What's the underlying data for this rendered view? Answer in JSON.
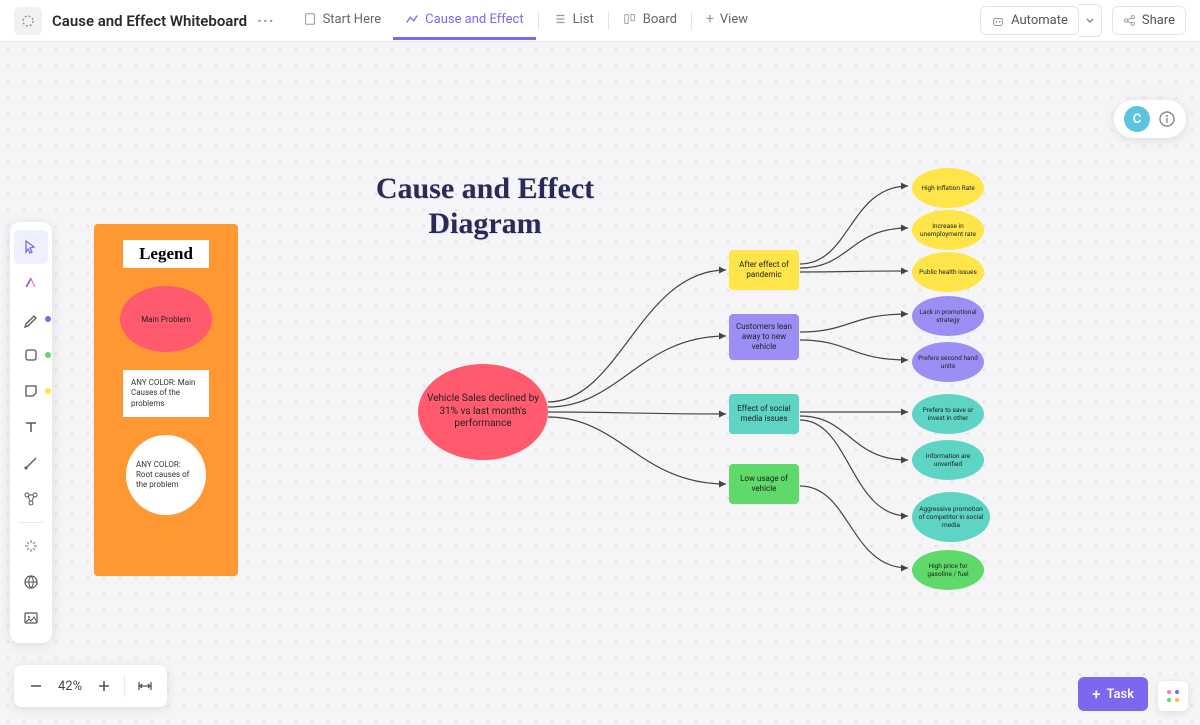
{
  "header": {
    "title": "Cause and Effect Whiteboard",
    "views": {
      "start": "Start Here",
      "active": "Cause and Effect",
      "list": "List",
      "board": "Board",
      "view": "View"
    },
    "automate": "Automate",
    "share": "Share"
  },
  "avatar": {
    "initial": "C"
  },
  "diagram": {
    "title": "Cause and Effect Diagram",
    "legend": {
      "title": "Legend",
      "main": "Main Problem",
      "causes": "ANY COLOR: Main Causes of the problems",
      "root": "ANY COLOR: Root causes of the problem"
    },
    "problem": "Vehicle Sales declined by 31% vs last month's performance",
    "causes": {
      "c1": "After effect of pandemic",
      "c2": "Customers lean away to new vehicle",
      "c3": "Effect of social media issues",
      "c4": "Low usage of vehicle"
    },
    "roots": {
      "r1": "High Inflation Rate",
      "r2": "Increase in unemployment rate",
      "r3": "Public health issues",
      "r4": "Lack in promotional strategy",
      "r5": "Prefers second hand units",
      "r6": "Prefers to save or invest in other",
      "r7": "Information are unverified",
      "r8": "Aggressive promotion of competitor in social media",
      "r9": "High price for gasoline / fuel"
    }
  },
  "zoom": {
    "value": "42%"
  },
  "task_button": "Task"
}
